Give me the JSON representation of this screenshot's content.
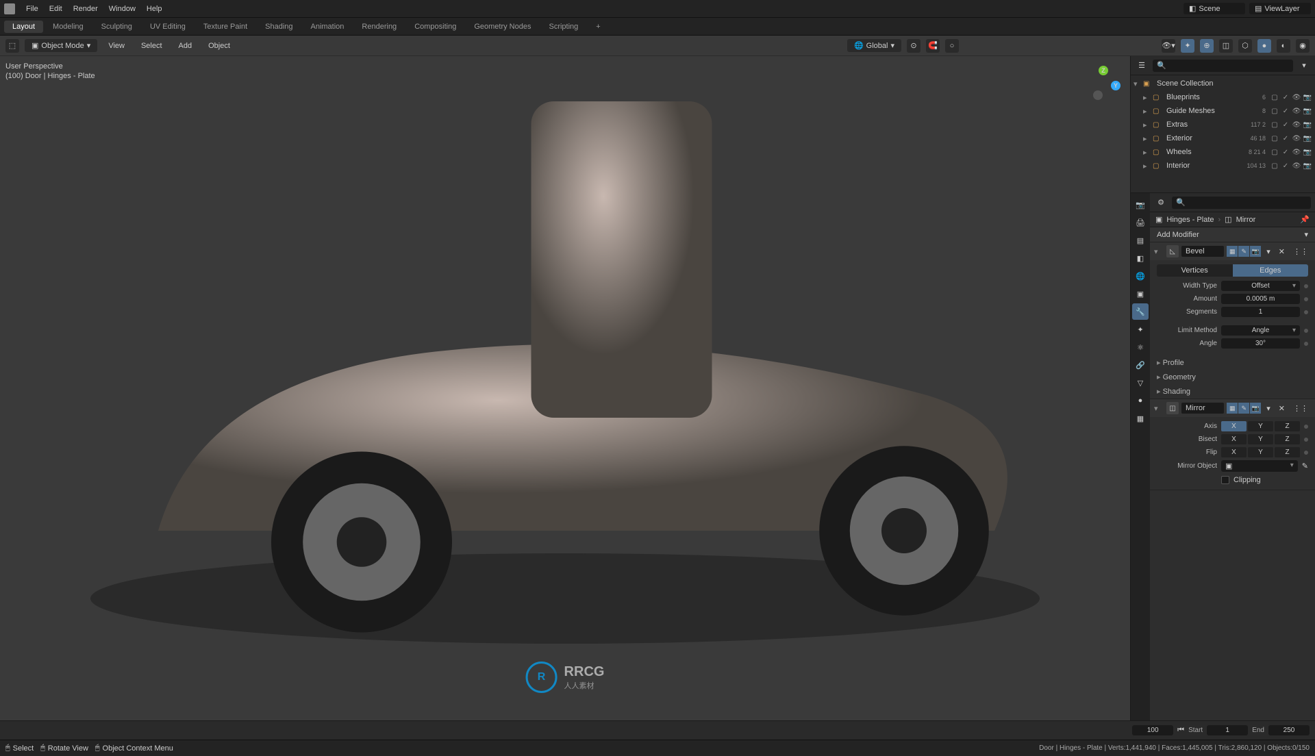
{
  "top_menu": [
    "File",
    "Edit",
    "Render",
    "Window",
    "Help"
  ],
  "workspaces": [
    "Layout",
    "Modeling",
    "Sculpting",
    "UV Editing",
    "Texture Paint",
    "Shading",
    "Animation",
    "Rendering",
    "Compositing",
    "Geometry Nodes",
    "Scripting"
  ],
  "active_workspace": "Layout",
  "scene_field": "Scene",
  "viewlayer_field": "ViewLayer",
  "toolbar": {
    "mode": "Object Mode",
    "menus": [
      "View",
      "Select",
      "Add",
      "Object"
    ],
    "orientation": "Global"
  },
  "viewport_label": {
    "line1": "User Perspective",
    "line2": "(100) Door | Hinges - Plate"
  },
  "axis_gizmo": {
    "y": "Y",
    "z": "Z"
  },
  "watermark": {
    "primary": "RRCG",
    "secondary": "人人素材"
  },
  "outliner": {
    "title": "Scene Collection",
    "rows": [
      {
        "name": "Blueprints",
        "stats": "6",
        "icons": "▢ ✓ 👁 📷"
      },
      {
        "name": "Guide Meshes",
        "stats": "8",
        "icons": "▢ ✓ 👁 📷"
      },
      {
        "name": "Extras",
        "stats": "117  2",
        "icons": "▢ ✓ 👁 📷"
      },
      {
        "name": "Exterior",
        "stats": "46 18",
        "icons": "▢ ✓ 👁 📷"
      },
      {
        "name": "Wheels",
        "stats": "8  21  4",
        "icons": "▢ ✓ 👁 📷"
      },
      {
        "name": "Interior",
        "stats": "104 13",
        "icons": "▢ ✓ 👁 📷"
      }
    ]
  },
  "breadcrumb": {
    "obj": "Hinges - Plate",
    "mod": "Mirror"
  },
  "add_modifier": "Add Modifier",
  "mod_bevel": {
    "name": "Bevel",
    "vertices_label": "Vertices",
    "edges_label": "Edges",
    "width_type_label": "Width Type",
    "width_type": "Offset",
    "amount_label": "Amount",
    "amount": "0.0005 m",
    "segments_label": "Segments",
    "segments": "1",
    "limit_label": "Limit Method",
    "limit": "Angle",
    "angle_label": "Angle",
    "angle": "30°",
    "sub_profile": "Profile",
    "sub_geometry": "Geometry",
    "sub_shading": "Shading"
  },
  "mod_mirror": {
    "name": "Mirror",
    "axis_label": "Axis",
    "bisect_label": "Bisect",
    "flip_label": "Flip",
    "mobj_label": "Mirror Object",
    "clipping": "Clipping",
    "X": "X",
    "Y": "Y",
    "Z": "Z"
  },
  "timeline": {
    "current": "100",
    "start_label": "Start",
    "start": "1",
    "end_label": "End",
    "end": "250"
  },
  "status": {
    "select": "Select",
    "rotate": "Rotate View",
    "ctx": "Object Context Menu",
    "stats": "Door | Hinges - Plate | Verts:1,441,940 | Faces:1,445,005 | Tris:2,860,120 | Objects:0/150"
  }
}
